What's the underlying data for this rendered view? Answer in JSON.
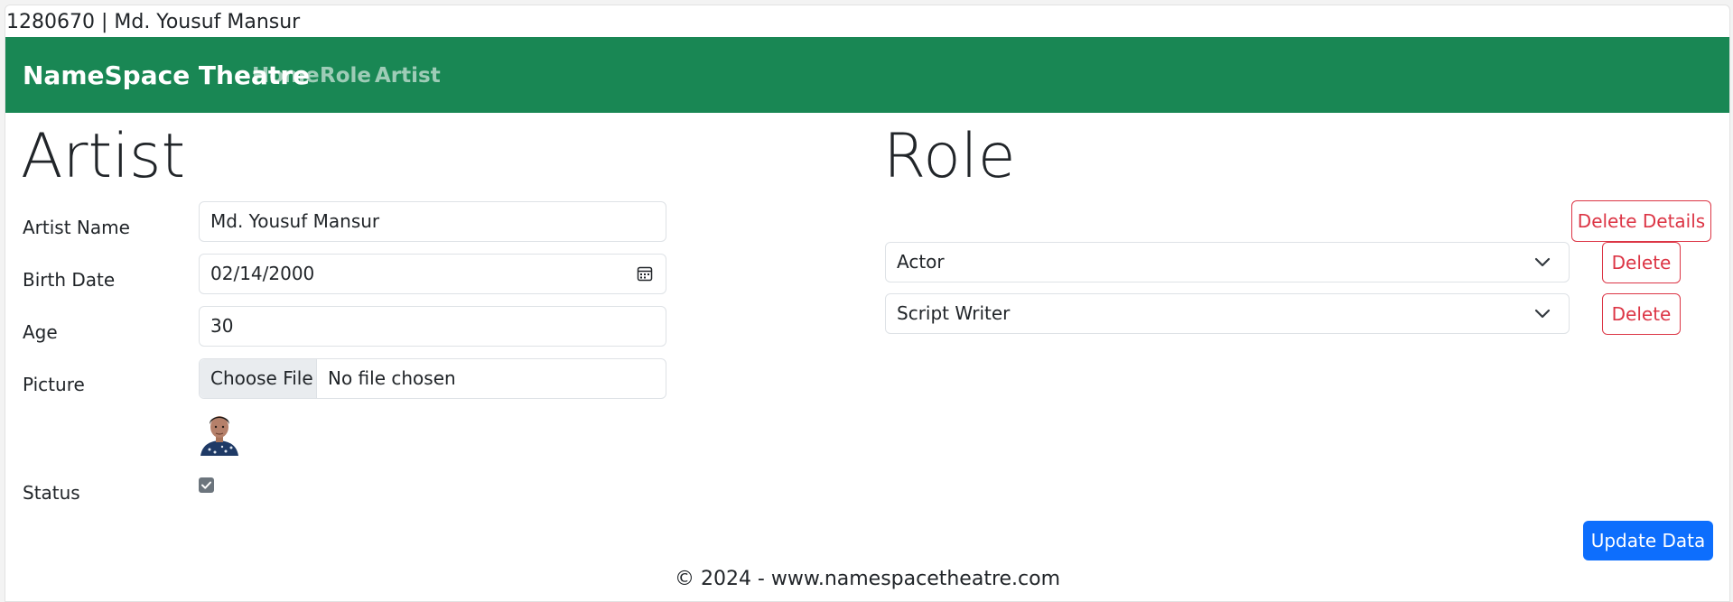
{
  "page": {
    "header_line": "1280670 | Md. Yousuf Mansur",
    "colors": {
      "navbar": "#198754",
      "danger": "#dc3545",
      "primary": "#0d6efd"
    }
  },
  "navbar": {
    "brand": "NameSpace Theatre",
    "links": [
      "Home",
      "Role",
      "Artist"
    ]
  },
  "artist": {
    "heading": "Artist",
    "fields": {
      "name_label": "Artist Name",
      "name_value": "Md. Yousuf Mansur",
      "birth_label": "Birth Date",
      "birth_value": "02/14/2000",
      "age_label": "Age",
      "age_value": "30",
      "picture_label": "Picture",
      "picture_button": "Choose File",
      "picture_status": "No file chosen",
      "status_label": "Status",
      "status_checked": true
    }
  },
  "role": {
    "heading": "Role",
    "delete_details_label": "Delete Details",
    "rows": [
      {
        "selected": "Actor",
        "delete_label": "Delete"
      },
      {
        "selected": "Script Writer",
        "delete_label": "Delete"
      }
    ]
  },
  "actions": {
    "update_label": "Update Data"
  },
  "footer": {
    "text": "© 2024 - www.namespacetheatre.com"
  }
}
